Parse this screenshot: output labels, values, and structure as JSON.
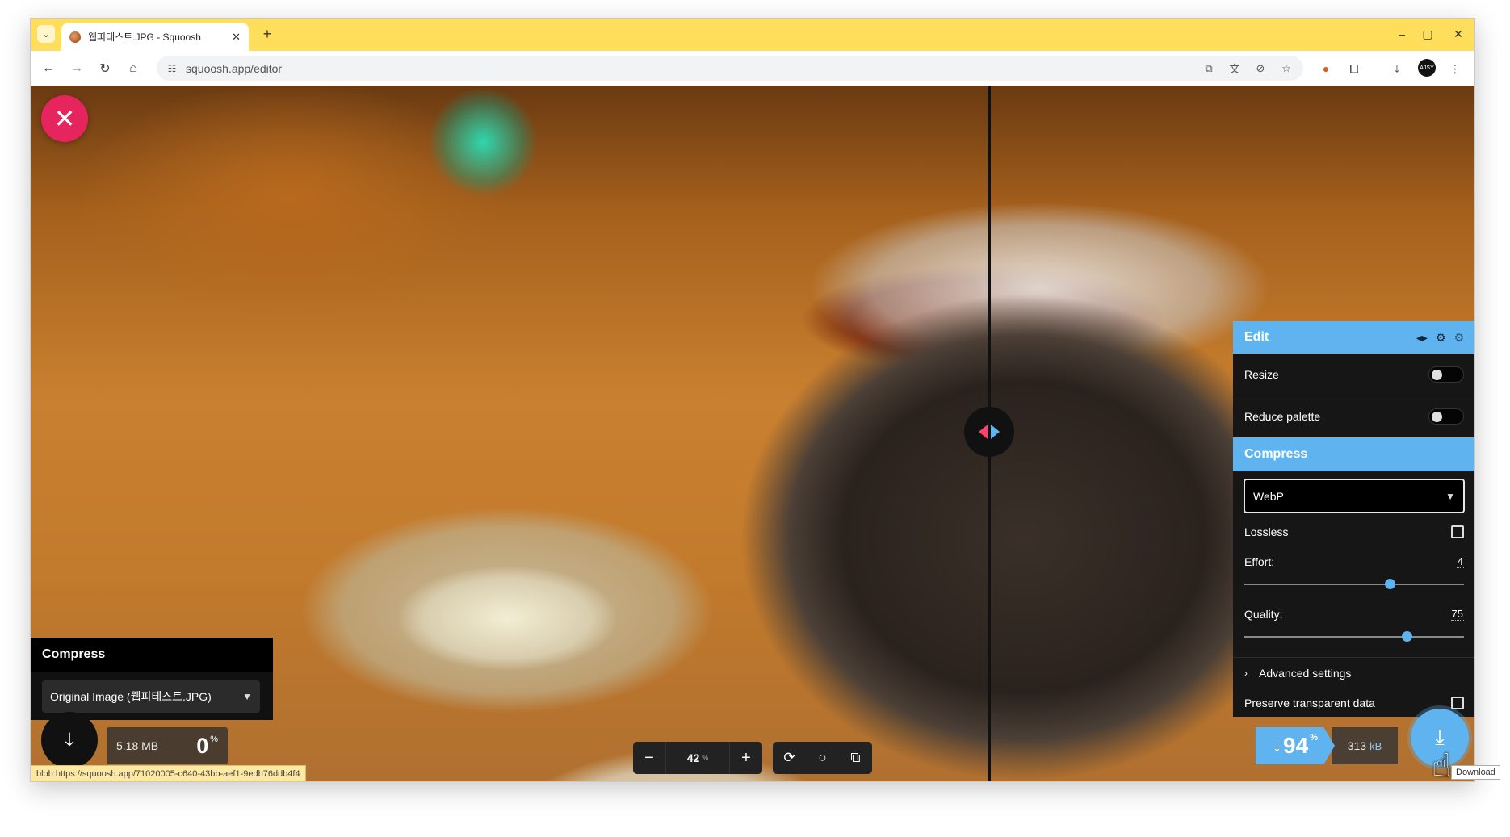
{
  "browser": {
    "tab_title": "웹피테스트.JPG - Squoosh",
    "url": "squoosh.app/editor",
    "new_tab_glyph": "+",
    "tab_close_glyph": "✕",
    "tab_dropdown_glyph": "⌄",
    "window_controls": {
      "minimize": "–",
      "maximize": "▢",
      "close": "✕"
    },
    "profile_label": "AJSY"
  },
  "editor": {
    "close_glyph": "✕",
    "left": {
      "header": "Compress",
      "source_select": "Original Image (웹피테스트.JPG)",
      "file_size": "5.18 MB",
      "percent": "0",
      "percent_sign": "%"
    },
    "zoom": {
      "value": "42",
      "unit": "%",
      "minus": "−",
      "plus": "+"
    },
    "right": {
      "edit_header": "Edit",
      "resize_label": "Resize",
      "reduce_palette_label": "Reduce palette",
      "compress_header": "Compress",
      "codec": "WebP",
      "lossless_label": "Lossless",
      "effort_label": "Effort:",
      "effort_value": "4",
      "effort_fraction": 0.66,
      "quality_label": "Quality:",
      "quality_value": "75",
      "quality_fraction": 0.74,
      "advanced_label": "Advanced settings",
      "preserve_label": "Preserve transparent data",
      "reduction_percent": "94",
      "reduction_arrow": "↓",
      "percent_sign": "%",
      "result_size": "313",
      "result_unit": "kB"
    },
    "status_url": "blob:https://squoosh.app/71020005-c640-43bb-aef1-9edb76ddb4f4",
    "tooltip": "Download"
  },
  "colors": {
    "tabbar": "#ffde5c",
    "accent_blue": "#5fb4f0",
    "close_pink": "#e6245d"
  }
}
